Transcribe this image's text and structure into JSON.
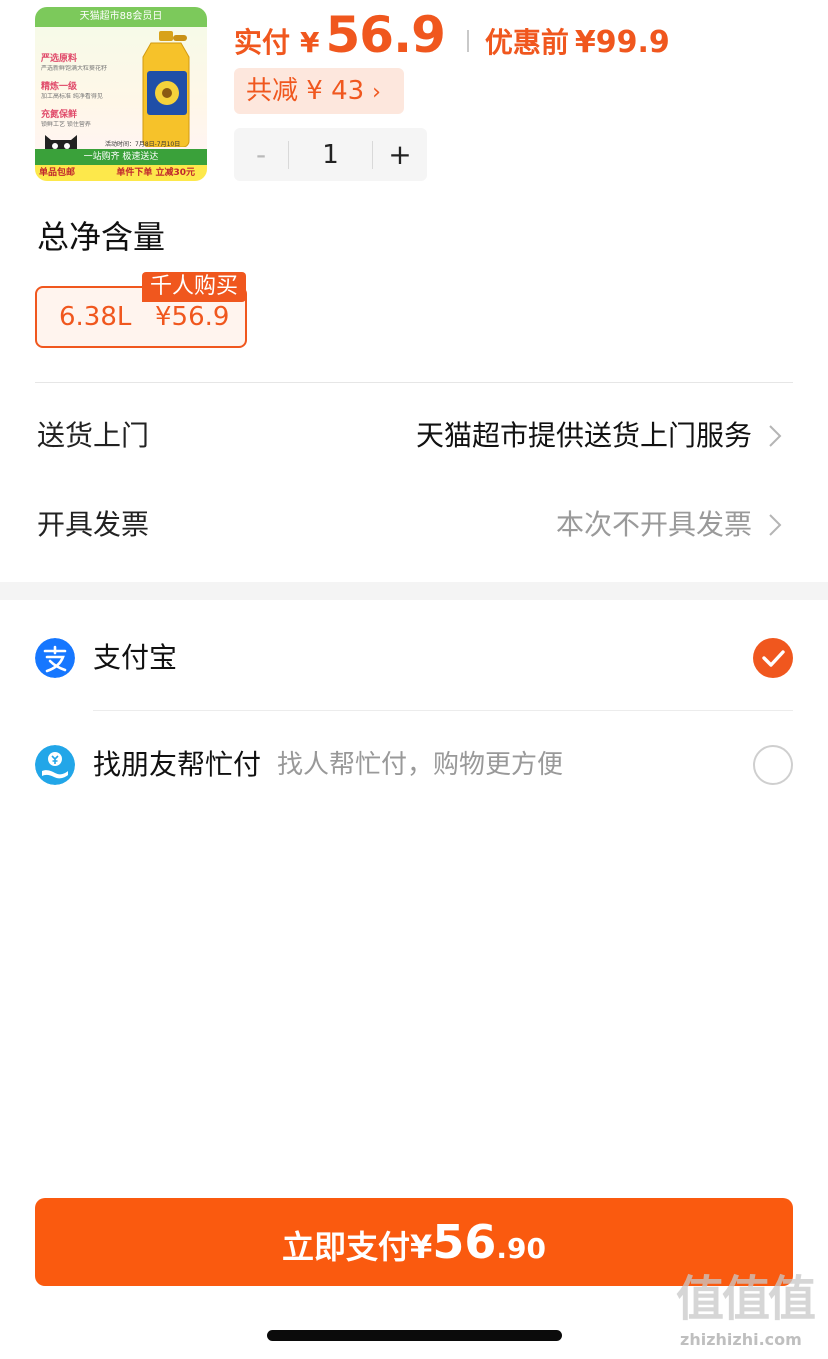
{
  "product": {
    "thumb_top_text": "天猫超市88会员日",
    "thumb_features": [
      {
        "title": "严选原料",
        "sub": "严选新鲜饱满大粒葵花籽"
      },
      {
        "title": "精炼一级",
        "sub": "加工高标准 纯净看得见"
      },
      {
        "title": "充氮保鲜",
        "sub": "锁鲜工艺 锁住营养"
      }
    ],
    "thumb_date": "活动时间：7月8日-7月10日",
    "thumb_strip": "一站购齐 极速送达",
    "thumb_bottom_left": "单品包邮",
    "thumb_bottom_right": "单件下单 立减30元",
    "pay_label": "实付",
    "yen": "¥",
    "pay_amount": "56.9",
    "original_label": "优惠前",
    "original_amount": "¥99.9",
    "discount_text": "共减 ¥ 43",
    "discount_chevron": "›",
    "quantity": "1",
    "minus": "-",
    "plus": "+"
  },
  "spec": {
    "section_title": "总净含量",
    "badge": "千人购买",
    "volume": "6.38L",
    "price": "¥56.9"
  },
  "rows": {
    "delivery_label": "送货上门",
    "delivery_value": "天猫超市提供送货上门服务",
    "invoice_label": "开具发票",
    "invoice_value": "本次不开具发票"
  },
  "payment": {
    "alipay_name": "支付宝",
    "alipay_selected": true,
    "friend_name": "找朋友帮忙付",
    "friend_desc": "找人帮忙付，购物更方便",
    "friend_selected": false
  },
  "pay_button": {
    "label": "立即支付¥",
    "amount_int": "56",
    "amount_dec": ".90"
  },
  "watermark": {
    "mark": "值值值",
    "text": "zhizhizhi.com"
  },
  "colors": {
    "accent": "#f0571e",
    "button": "#fa5a0f",
    "alipay_blue": "#1677ff"
  },
  "icons": [
    "tmall-cat-icon",
    "oil-bottle-icon",
    "chevron-right-icon",
    "alipay-icon",
    "friend-pay-icon",
    "check-icon"
  ]
}
